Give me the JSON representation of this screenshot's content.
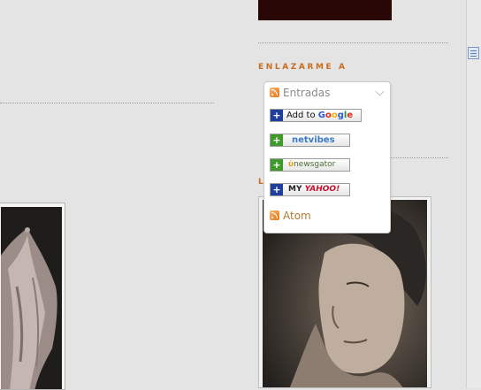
{
  "sidebar": {
    "section_title": "ENLAZARME A",
    "partial_title": "L"
  },
  "subscribe_menu": {
    "header_label": "Entradas",
    "buttons": [
      {
        "id": "google",
        "label": "Add to Google"
      },
      {
        "id": "netvibes",
        "label": "netvibes"
      },
      {
        "id": "newsgator",
        "label": "newsgator"
      },
      {
        "id": "yahoo",
        "label": "MY YAHOO!"
      }
    ],
    "atom_label": "Atom"
  },
  "icons": [
    "rss-feed-icon",
    "chevron-down-icon",
    "plus-icon",
    "page-icon"
  ],
  "colors": {
    "background": "#e4e4e4",
    "section_title": "#c86d1f",
    "banner": "#2a0707",
    "atom_link": "#b07a35"
  }
}
